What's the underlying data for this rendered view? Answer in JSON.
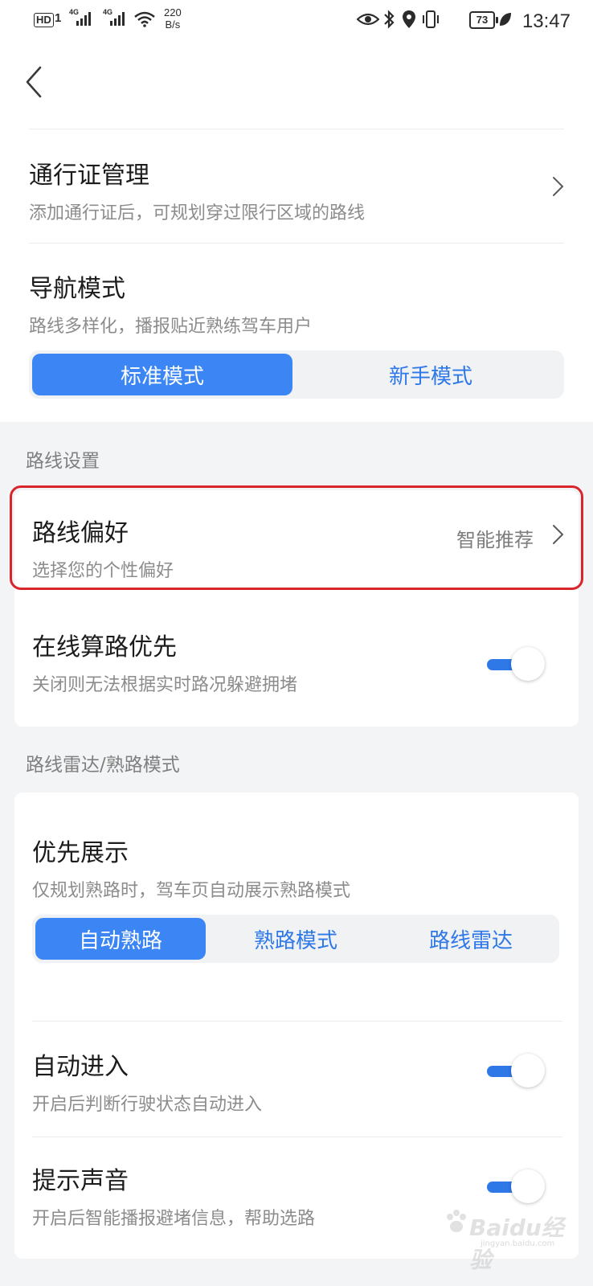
{
  "status_bar": {
    "hd": "HD",
    "sim": "1",
    "net1": "4G",
    "net2": "4G",
    "speed_value": "220",
    "speed_unit": "B/s",
    "battery": "73",
    "time": "13:47"
  },
  "pass_management": {
    "title": "通行证管理",
    "subtitle": "添加通行证后，可规划穿过限行区域的路线"
  },
  "nav_mode": {
    "title": "导航模式",
    "subtitle": "路线多样化，播报贴近熟练驾车用户",
    "options": [
      "标准模式",
      "新手模式"
    ],
    "selected": "标准模式"
  },
  "route_settings": {
    "section_label": "路线设置",
    "preference": {
      "title": "路线偏好",
      "subtitle": "选择您的个性偏好",
      "value": "智能推荐"
    },
    "online_routing": {
      "title": "在线算路优先",
      "subtitle": "关闭则无法根据实时路况躲避拥堵",
      "enabled": true
    }
  },
  "radar": {
    "section_label": "路线雷达/熟路模式",
    "priority_display": {
      "title": "优先展示",
      "subtitle": "仅规划熟路时，驾车页自动展示熟路模式",
      "options": [
        "自动熟路",
        "熟路模式",
        "路线雷达"
      ],
      "selected": "自动熟路"
    },
    "auto_enter": {
      "title": "自动进入",
      "subtitle": "开启后判断行驶状态自动进入",
      "enabled": true
    },
    "sound": {
      "title": "提示声音",
      "subtitle": "开启后智能播报避堵信息，帮助选路",
      "enabled": true
    }
  },
  "watermark": {
    "text": "Baidu经验",
    "url": "jingyan.baidu.com"
  },
  "colors": {
    "accent": "#3b86f4",
    "highlight_border": "#d9262c"
  }
}
